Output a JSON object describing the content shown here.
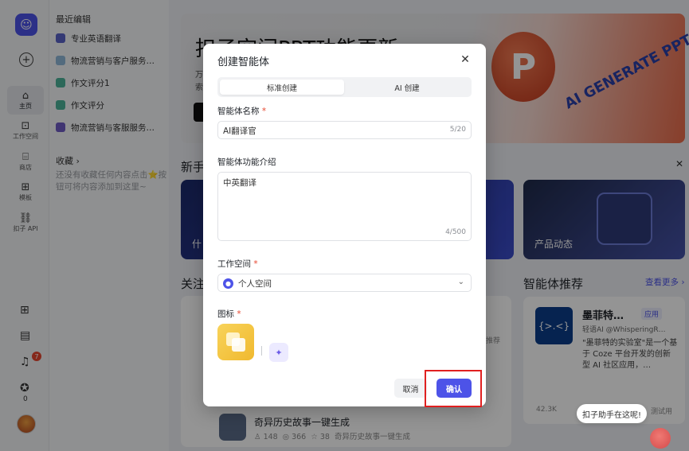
{
  "rail": {
    "items": [
      {
        "label": "主页",
        "icon": "home-icon"
      },
      {
        "label": "工作空间",
        "icon": "terminal-icon"
      },
      {
        "label": "商店",
        "icon": "store-icon"
      },
      {
        "label": "模板",
        "icon": "template-icon"
      },
      {
        "label": "扣子 API",
        "icon": "api-icon"
      }
    ],
    "notification_count": "7",
    "points": "0"
  },
  "sidebar": {
    "recent_title": "最近编辑",
    "recent": [
      {
        "label": "专业英语翻译",
        "color": "#5b63c9"
      },
      {
        "label": "物流营销与客户服务…",
        "color": "#8fb8d9"
      },
      {
        "label": "作文评分1",
        "color": "#4cb39a"
      },
      {
        "label": "作文评分",
        "color": "#4cb39a"
      },
      {
        "label": "物流营销与客服服务…",
        "color": "#6f5cc4"
      }
    ],
    "favorites_title": "收藏",
    "favorites_empty": "还没有收藏任何内容点击⭐按钮可将内容添加到这里~"
  },
  "main": {
    "banner_title": "扣子空间PPT功能更新",
    "banner_sub1": "万",
    "banner_sub2": "索",
    "banner_badge": "P",
    "banner_ai": "AI GENERATE PPT",
    "newbie_title": "新手",
    "card_what": "什",
    "card_product": "产品动态",
    "follow_title": "关注",
    "recommend_title": "智能体推荐",
    "see_more": "查看更多",
    "rec_card": {
      "name": "墨菲特…",
      "tag": "应用",
      "author": "轻语AI @WhisperingR…",
      "desc": "\"墨菲特的实验室\"是一个基于 Coze 平台开发的创新型 AI 社区应用，…",
      "stat": "42.3K",
      "extra": "测试用"
    },
    "list_item": {
      "title": "奇异历史故事一键生成",
      "users": "148",
      "views": "366",
      "tokens": "38",
      "desc": "奇异历史故事一键生成"
    },
    "hidden_tag": "推荐"
  },
  "modal": {
    "title": "创建智能体",
    "tabs": [
      "标准创建",
      "AI 创建"
    ],
    "name_label": "智能体名称",
    "name_value": "AI翻译官",
    "name_count": "5/20",
    "desc_label": "智能体功能介绍",
    "desc_value": "中英翻译",
    "desc_count": "4/500",
    "space_label": "工作空间",
    "space_value": "个人空间",
    "icon_label": "图标",
    "cancel": "取消",
    "confirm": "确认"
  },
  "help_bubble": "扣子助手在这呢!"
}
